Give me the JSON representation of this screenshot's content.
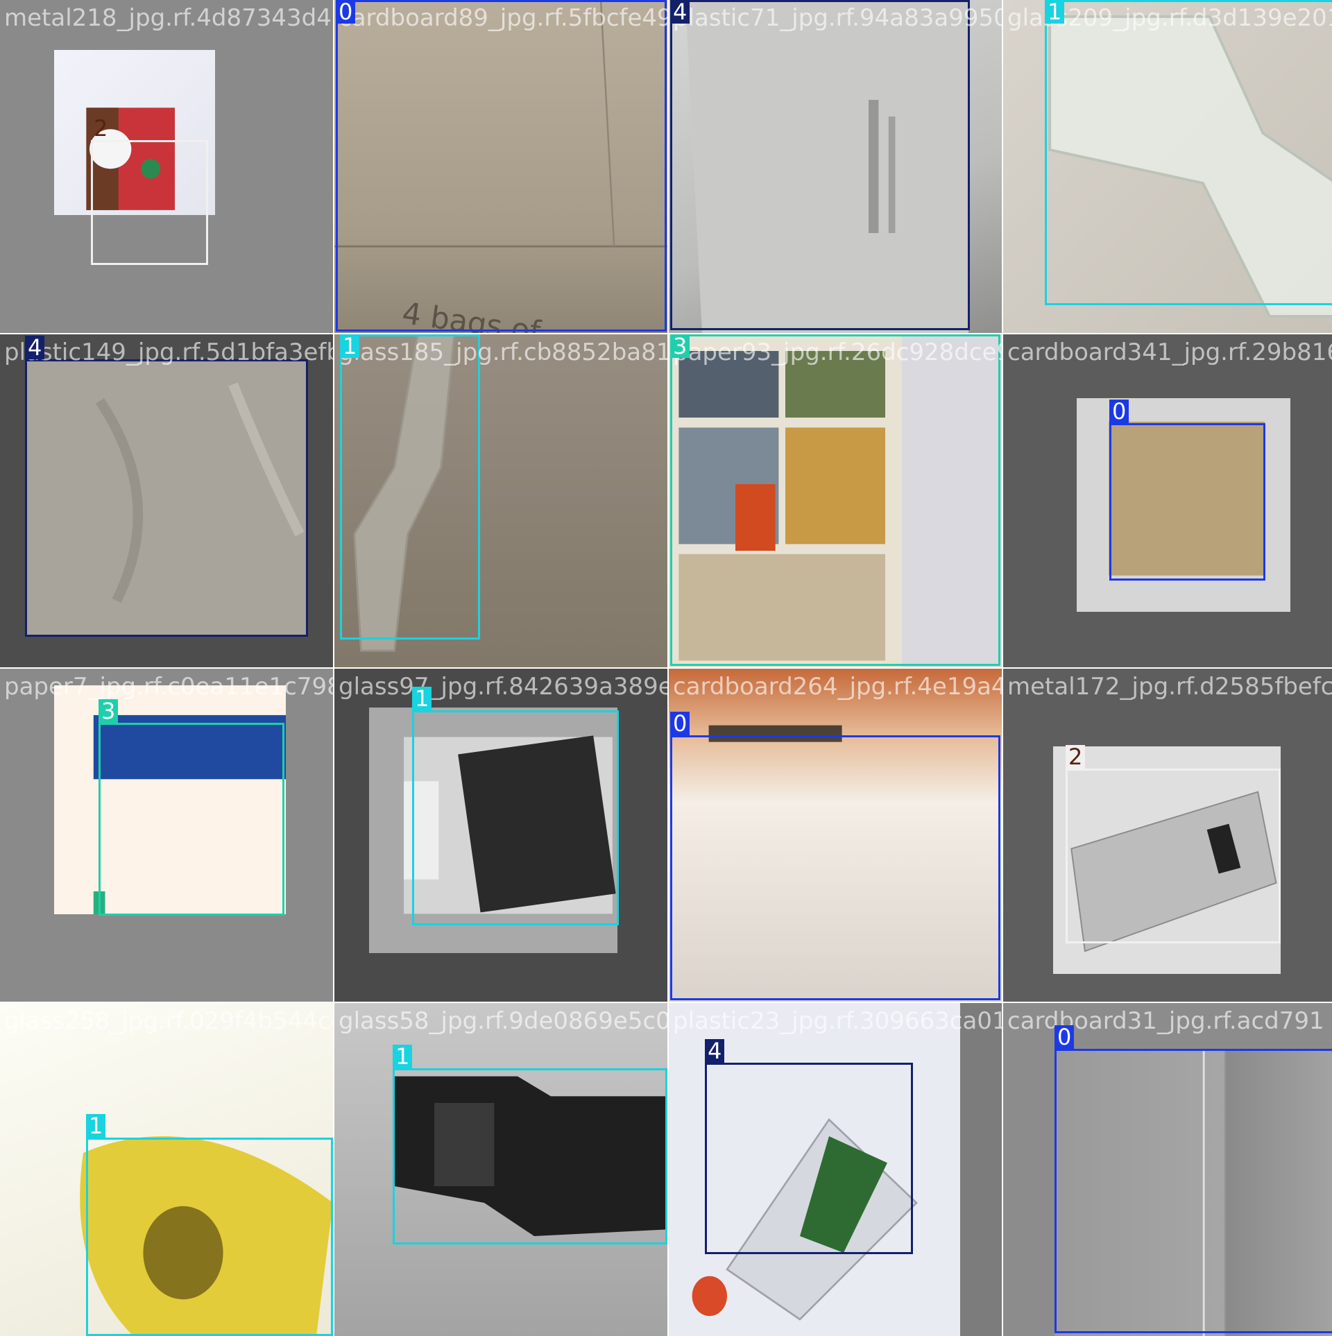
{
  "class_colors": {
    "0": "#1c39e6",
    "1": "#18d3e0",
    "2": "#f0f0f0",
    "3": "#1fcfab",
    "4": "#13206b"
  },
  "tiles": [
    {
      "filename": "metal218_jpg.rf.4d87343d46fc23ce5f7f62921",
      "boxes": [
        {
          "cls": "2"
        }
      ]
    },
    {
      "filename": "cardboard89_jpg.rf.5fbcfe494aed2a7b9fbe",
      "boxes": [
        {
          "cls": "0"
        }
      ]
    },
    {
      "filename": "plastic71_jpg.rf.94a83a9950abd27697634",
      "boxes": [
        {
          "cls": "4"
        }
      ]
    },
    {
      "filename": "glass209_jpg.rf.d3d139e2010638",
      "boxes": [
        {
          "cls": "1"
        }
      ]
    },
    {
      "filename": "plastic149_jpg.rf.5d1bfa3efb5f12e205c768",
      "boxes": [
        {
          "cls": "4"
        }
      ]
    },
    {
      "filename": "glass185_jpg.rf.cb8852ba81f7ab38213d712",
      "boxes": [
        {
          "cls": "1"
        }
      ]
    },
    {
      "filename": "paper93_jpg.rf.26dc928dce9ae16bd13d38",
      "boxes": [
        {
          "cls": "3"
        }
      ]
    },
    {
      "filename": "cardboard341_jpg.rf.29b816",
      "boxes": [
        {
          "cls": "0"
        }
      ]
    },
    {
      "filename": "paper7_jpg.rf.c0ea11e1c79882e0ff5c0058",
      "boxes": [
        {
          "cls": "3"
        }
      ]
    },
    {
      "filename": "glass97_jpg.rf.842639a389eaed14ebb82c",
      "boxes": [
        {
          "cls": "1"
        }
      ]
    },
    {
      "filename": "cardboard264_jpg.rf.4e19a4446f4307",
      "boxes": [
        {
          "cls": "0"
        }
      ]
    },
    {
      "filename": "metal172_jpg.rf.d2585fbefc9be",
      "boxes": [
        {
          "cls": "2"
        }
      ]
    },
    {
      "filename": "glass258_jpg.rf.029f4b544ce3996437e8e5",
      "boxes": [
        {
          "cls": "1"
        }
      ]
    },
    {
      "filename": "glass58_jpg.rf.9de0869e5c0f9ab64bf8e2175",
      "boxes": [
        {
          "cls": "1"
        }
      ]
    },
    {
      "filename": "plastic23_jpg.rf.309663ca0106f7ca9557",
      "boxes": [
        {
          "cls": "4"
        }
      ]
    },
    {
      "filename": "cardboard31_jpg.rf.acd791",
      "boxes": [
        {
          "cls": "0"
        }
      ]
    }
  ]
}
